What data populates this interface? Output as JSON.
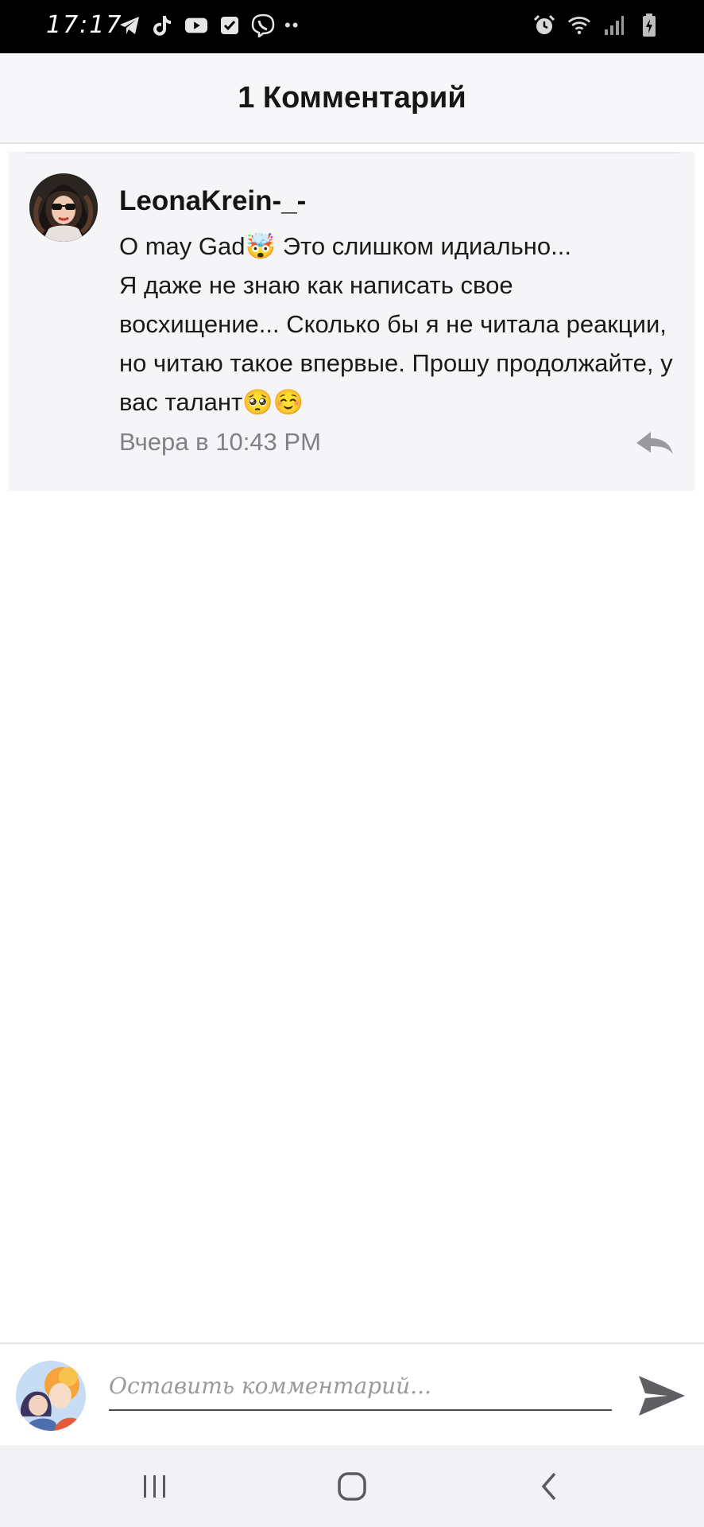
{
  "status_bar": {
    "time": "17:17",
    "left_icons": [
      "telegram-icon",
      "tiktok-icon",
      "youtube-icon",
      "checkbox-icon",
      "viber-icon"
    ],
    "more_dots": "••",
    "right_icons": [
      "alarm-icon",
      "wifi-icon",
      "signal-icon",
      "battery-icon"
    ]
  },
  "header": {
    "title": "1 Комментарий"
  },
  "comment": {
    "author": "LeonaKrein-_-",
    "text": "O may Gad🤯 Это слишком идиально...\nЯ даже не знаю как написать свое восхищение... Сколько бы я не читала реакции, но читаю такое впервые. Прошу продолжайте, у вас талант🥺☺️",
    "time": "Вчера в 10:43 PM"
  },
  "input": {
    "placeholder": "Оставить комментарий...",
    "value": ""
  },
  "colors": {
    "header_bg": "#f7f6f8",
    "card_bg": "#f5f4f7",
    "muted_text": "#808085",
    "icon_gray": "#5f5f63"
  }
}
